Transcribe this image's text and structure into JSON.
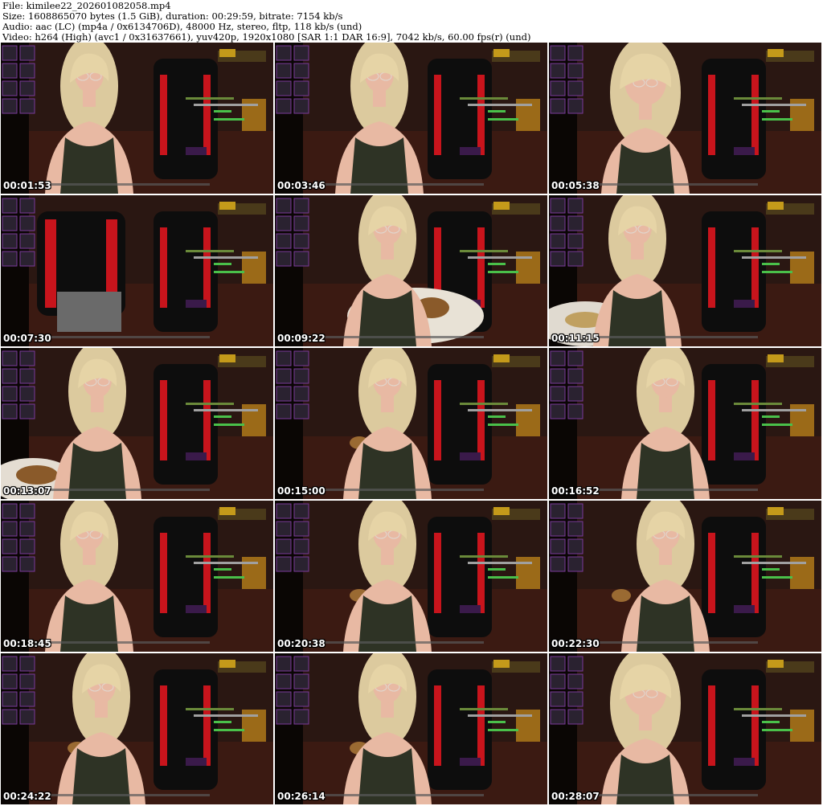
{
  "header": {
    "file_line": "File: kimilee22_202601082058.mp4",
    "size_line": "Size: 1608865070 bytes (1.5 GiB), duration: 00:29:59, bitrate: 7154 kb/s",
    "audio_line": "Audio: aac (LC) (mp4a / 0x6134706D), 48000 Hz, stereo, fltp, 118 kb/s (und)",
    "video_line": "Video: h264 (High) (avc1 / 0x31637661), yuv420p, 1920x1080 [SAR 1:1 DAR 16:9], 7042 kb/s, 60.00 fps(r) (und)"
  },
  "thumbnails": [
    {
      "timestamp": "00:01:53",
      "scene": "seated-left"
    },
    {
      "timestamp": "00:03:46",
      "scene": "seated-center"
    },
    {
      "timestamp": "00:05:38",
      "scene": "closeup"
    },
    {
      "timestamp": "00:07:30",
      "scene": "empty-chair"
    },
    {
      "timestamp": "00:09:22",
      "scene": "plate"
    },
    {
      "timestamp": "00:11:15",
      "scene": "plate-right"
    },
    {
      "timestamp": "00:13:07",
      "scene": "plate-left"
    },
    {
      "timestamp": "00:15:00",
      "scene": "eating-center"
    },
    {
      "timestamp": "00:16:52",
      "scene": "leaning-right"
    },
    {
      "timestamp": "00:18:45",
      "scene": "seated-left"
    },
    {
      "timestamp": "00:20:38",
      "scene": "eating-center"
    },
    {
      "timestamp": "00:22:30",
      "scene": "eating-right"
    },
    {
      "timestamp": "00:24:22",
      "scene": "eating-left"
    },
    {
      "timestamp": "00:26:14",
      "scene": "eating-center"
    },
    {
      "timestamp": "00:28:07",
      "scene": "closeup"
    }
  ],
  "colors": {
    "hair": "#e6d4a6",
    "skin": "#e8b9a3",
    "dress": "#2e3325",
    "chair": "#0d0d0d",
    "chair_accent": "#c8141c",
    "wall": "#2a1712",
    "floor": "#3b1a12"
  }
}
